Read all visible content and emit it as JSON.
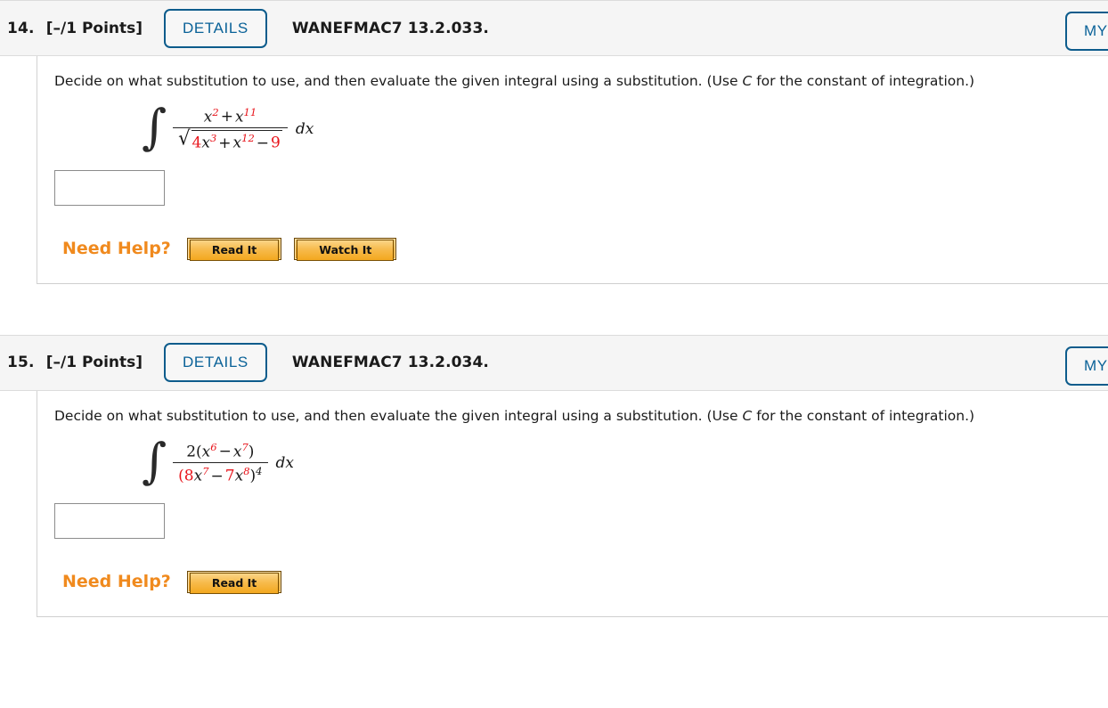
{
  "problems": [
    {
      "number": "14.",
      "points": "[–/1 Points]",
      "details_label": "DETAILS",
      "code": "WANEFMAC7 13.2.033.",
      "my_notes_label": "MY N",
      "prompt_part1": "Decide on what substitution to use, and then evaluate the given integral using a substitution. (Use ",
      "prompt_italic": "C",
      "prompt_part2": " for the constant of integration.)",
      "answer_value": "",
      "need_help_label": "Need Help?",
      "help_buttons": [
        "Read It",
        "Watch It"
      ],
      "math": {
        "integral_sign": "∫",
        "dx": "dx",
        "numerator": [
          {
            "t": "x",
            "style": "var"
          },
          {
            "t": "2",
            "style": "exp-red"
          },
          {
            "t": "+",
            "style": "op"
          },
          {
            "t": "x",
            "style": "var"
          },
          {
            "t": "11",
            "style": "exp-red"
          }
        ],
        "denominator_radical": true,
        "denominator": [
          {
            "t": "4",
            "style": "num-red"
          },
          {
            "t": "x",
            "style": "var"
          },
          {
            "t": "3",
            "style": "exp-red"
          },
          {
            "t": "+",
            "style": "op"
          },
          {
            "t": "x",
            "style": "var"
          },
          {
            "t": "12",
            "style": "exp-red"
          },
          {
            "t": "−",
            "style": "op"
          },
          {
            "t": "9",
            "style": "num-red"
          }
        ]
      }
    },
    {
      "number": "15.",
      "points": "[–/1 Points]",
      "details_label": "DETAILS",
      "code": "WANEFMAC7 13.2.034.",
      "my_notes_label": "MY N",
      "prompt_part1": "Decide on what substitution to use, and then evaluate the given integral using a substitution. (Use ",
      "prompt_italic": "C",
      "prompt_part2": " for the constant of integration.)",
      "answer_value": "",
      "need_help_label": "Need Help?",
      "help_buttons": [
        "Read It"
      ],
      "math": {
        "integral_sign": "∫",
        "dx": "dx",
        "numerator": [
          {
            "t": "2(",
            "style": "plain"
          },
          {
            "t": "x",
            "style": "var"
          },
          {
            "t": "6",
            "style": "exp-red"
          },
          {
            "t": "−",
            "style": "op"
          },
          {
            "t": "x",
            "style": "var"
          },
          {
            "t": "7",
            "style": "exp-red"
          },
          {
            "t": ")",
            "style": "plain"
          }
        ],
        "denominator_radical": false,
        "denominator": [
          {
            "t": "(",
            "style": "red-plain"
          },
          {
            "t": "8",
            "style": "num-red"
          },
          {
            "t": "x",
            "style": "var"
          },
          {
            "t": "7",
            "style": "exp-red"
          },
          {
            "t": "−",
            "style": "op"
          },
          {
            "t": "7",
            "style": "num-red"
          },
          {
            "t": "x",
            "style": "var"
          },
          {
            "t": "8",
            "style": "exp-red"
          },
          {
            "t": ")",
            "style": "plain"
          },
          {
            "t": "4",
            "style": "exp-plain"
          }
        ]
      }
    }
  ],
  "colors": {
    "accent_blue": "#0a6298",
    "math_red": "#e8131a",
    "help_orange": "#f08a1e",
    "header_bg": "#f5f5f5"
  }
}
